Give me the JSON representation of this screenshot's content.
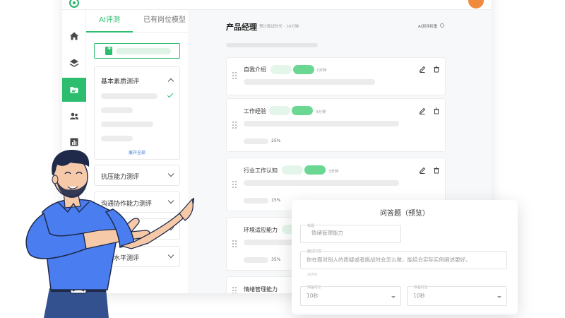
{
  "panel": {
    "tabs": [
      {
        "label": "AI评测"
      },
      {
        "label": "已有岗位模型"
      }
    ],
    "categories": [
      {
        "label": "基本素质测评",
        "expand_link": "展开全部"
      },
      {
        "label": "抗压能力测评"
      },
      {
        "label": "沟通协作能力测评"
      },
      {
        "label": "形象水平测评"
      }
    ]
  },
  "header": {
    "job_title": "产品经理",
    "job_meta": "预计面试时长 · 30分钟",
    "weight_link": "AI测评权重"
  },
  "questions": [
    {
      "title": "自我介绍",
      "duration": "1分钟"
    },
    {
      "title": "工作经验",
      "duration": "3分钟",
      "percent": "25%"
    },
    {
      "title": "行业工作认知",
      "duration": "3分钟",
      "percent": "15%"
    },
    {
      "title": "环境适应能力",
      "percent": "35%"
    },
    {
      "title": "情绪管理能力"
    }
  ],
  "modal": {
    "title": "问答题（预览）",
    "title_label": "标题",
    "title_value": "情绪管理能力",
    "content_label": "面试内容",
    "content_value": "你在面对别人的质疑或者挑战时会怎么做，能结合实际实例阐述更好。",
    "char_count": "20/50",
    "prep_label": "准备时长",
    "prep_value": "10秒",
    "answer_label": "准备时长",
    "answer_value": "10秒"
  },
  "colors": {
    "accent": "#2cbd6f",
    "avatar": "#f08a3c",
    "character_shirt": "#4a7ef0"
  }
}
